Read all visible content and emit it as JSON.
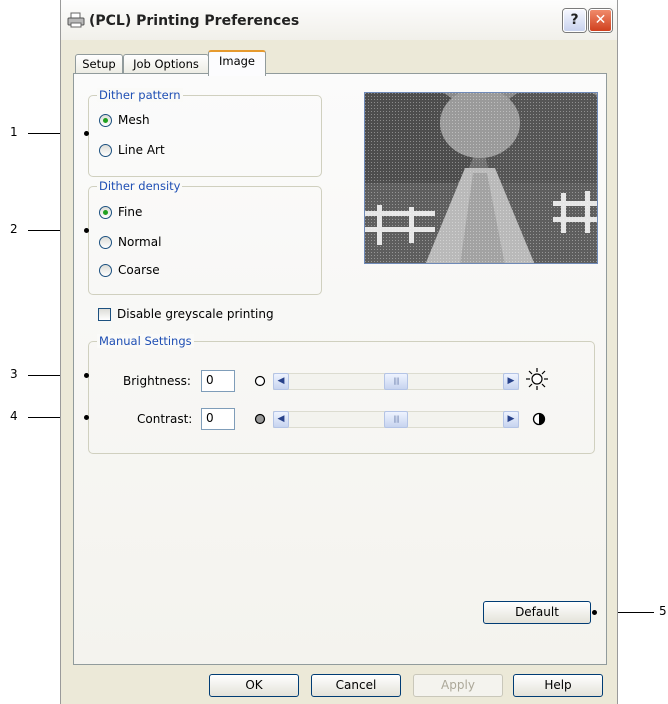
{
  "window": {
    "title": "(PCL) Printing Preferences",
    "help_label": "?",
    "close_label": "✕"
  },
  "tabs": [
    {
      "label": "Setup"
    },
    {
      "label": "Job Options"
    },
    {
      "label": "Image"
    }
  ],
  "dither_pattern": {
    "label": "Dither pattern",
    "options": [
      {
        "label": "Mesh",
        "selected": true
      },
      {
        "label": "Line Art",
        "selected": false
      }
    ]
  },
  "dither_density": {
    "label": "Dither density",
    "options": [
      {
        "label": "Fine",
        "selected": true
      },
      {
        "label": "Normal",
        "selected": false
      },
      {
        "label": "Coarse",
        "selected": false
      }
    ]
  },
  "greyscale": {
    "label": "Disable greyscale printing",
    "checked": false
  },
  "manual": {
    "label": "Manual Settings",
    "brightness": {
      "label": "Brightness:",
      "value": "0",
      "level": 0.5
    },
    "contrast": {
      "label": "Contrast:",
      "value": "0",
      "level": 0.5
    }
  },
  "buttons": {
    "default": "Default",
    "ok": "OK",
    "cancel": "Cancel",
    "apply": "Apply",
    "help": "Help"
  },
  "callouts": [
    "1",
    "2",
    "3",
    "4",
    "5"
  ],
  "icons": {
    "scroll_left": "◀",
    "scroll_right": "▶",
    "grip": "||||"
  }
}
